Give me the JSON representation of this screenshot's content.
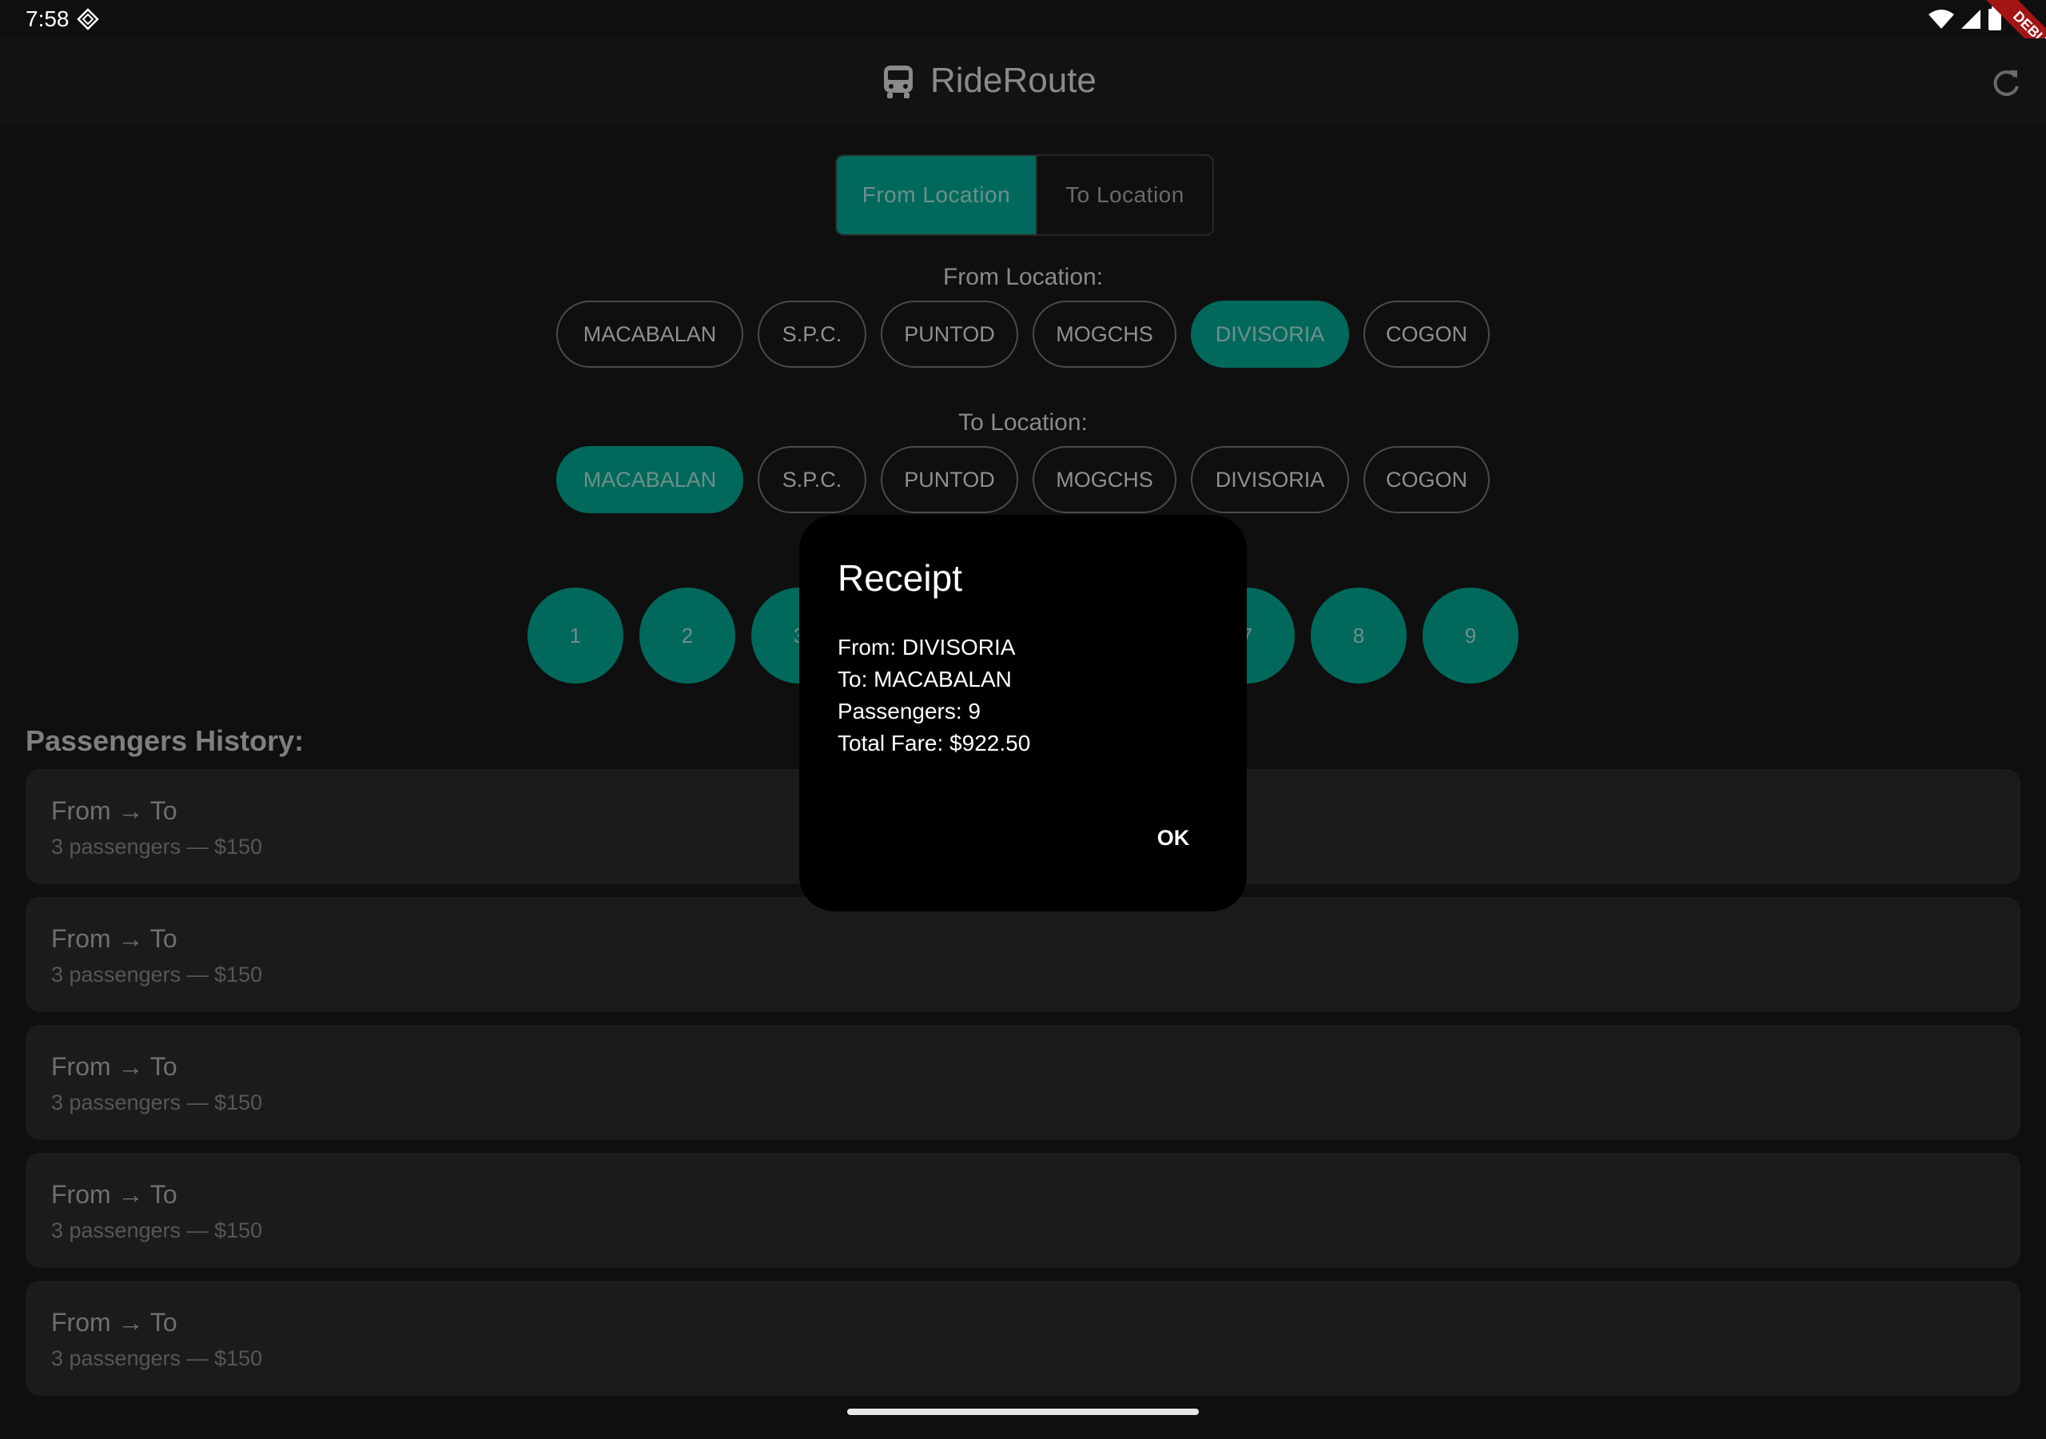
{
  "status": {
    "time": "7:58",
    "debug": "DEBUG"
  },
  "app": {
    "title": "RideRoute"
  },
  "toggle": {
    "from": "From Location",
    "to": "To Location"
  },
  "from_section": {
    "label": "From Location:",
    "chips": [
      "MACABALAN",
      "S.P.C.",
      "PUNTOD",
      "MOGCHS",
      "DIVISORIA",
      "COGON"
    ],
    "selected": "DIVISORIA"
  },
  "to_section": {
    "label": "To Location:",
    "chips": [
      "MACABALAN",
      "S.P.C.",
      "PUNTOD",
      "MOGCHS",
      "DIVISORIA",
      "COGON"
    ],
    "selected": "MACABALAN"
  },
  "passenger_buttons": [
    "1",
    "2",
    "3",
    "7",
    "8",
    "9"
  ],
  "history": {
    "title": "Passengers History:",
    "items": [
      {
        "title": "From → To",
        "subtitle": "3 passengers — $150"
      },
      {
        "title": "From → To",
        "subtitle": "3 passengers — $150"
      },
      {
        "title": "From → To",
        "subtitle": "3 passengers — $150"
      },
      {
        "title": "From → To",
        "subtitle": "3 passengers — $150"
      },
      {
        "title": "From → To",
        "subtitle": "3 passengers — $150"
      }
    ]
  },
  "dialog": {
    "title": "Receipt",
    "from": "From: DIVISORIA",
    "to": "To: MACABALAN",
    "passengers": "Passengers: 9",
    "fare": "Total Fare: $922.50",
    "ok": "OK"
  },
  "colors": {
    "accent": "#00695c",
    "background": "#0f0f0f",
    "card": "#1b1b1b"
  }
}
